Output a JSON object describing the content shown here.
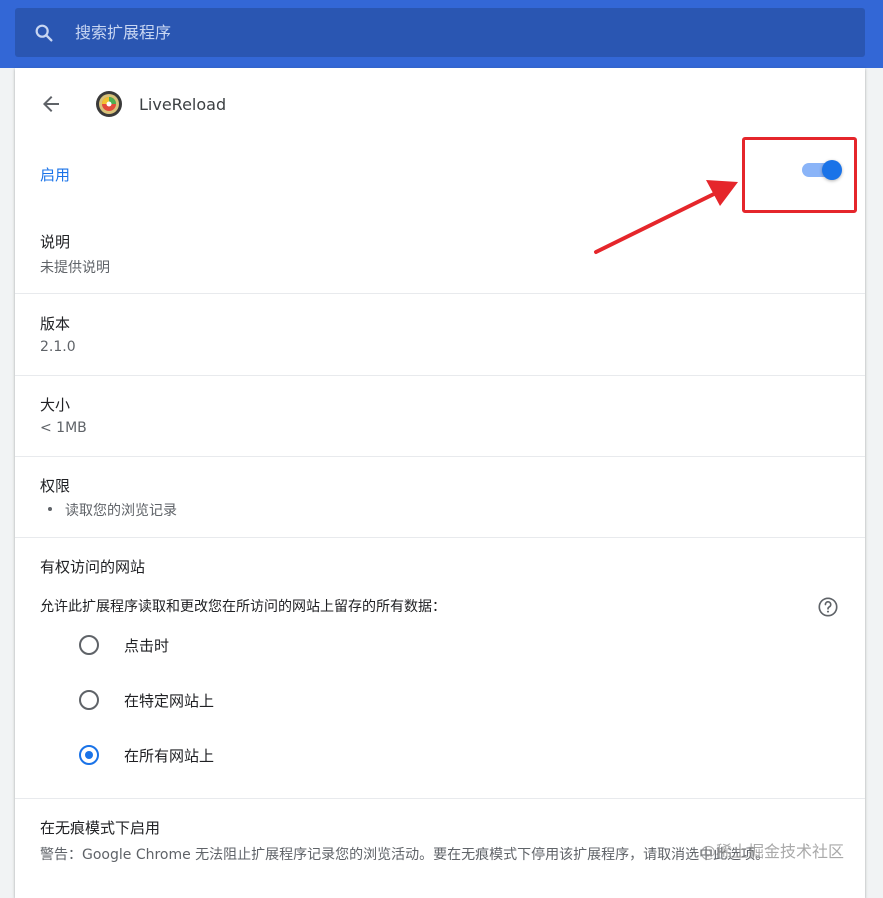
{
  "search": {
    "placeholder": "搜索扩展程序"
  },
  "extension": {
    "name": "LiveReload"
  },
  "enable": {
    "label": "启用",
    "on": true
  },
  "sections": {
    "description": {
      "title": "说明",
      "value": "未提供说明"
    },
    "version": {
      "title": "版本",
      "value": "2.1.0"
    },
    "size": {
      "title": "大小",
      "value": "< 1MB"
    },
    "permissions": {
      "title": "权限",
      "items": [
        "读取您的浏览记录"
      ]
    }
  },
  "site_access": {
    "title": "有权访问的网站",
    "description": "允许此扩展程序读取和更改您在所访问的网站上留存的所有数据：",
    "options": [
      {
        "label": "点击时",
        "checked": false
      },
      {
        "label": "在特定网站上",
        "checked": false
      },
      {
        "label": "在所有网站上",
        "checked": true
      }
    ]
  },
  "incognito": {
    "title": "在无痕模式下启用",
    "warning": "警告：Google Chrome 无法阻止扩展程序记录您的浏览活动。要在无痕模式下停用该扩展程序，请取消选中此选项。"
  },
  "watermark": "@稀土掘金技术社区",
  "colors": {
    "accent": "#1a73e8",
    "topbar": "#3367d6",
    "annotation": "#e5262b"
  },
  "icons": {
    "search": "search-icon",
    "back": "arrow-back-icon",
    "help": "help-circle-icon"
  }
}
